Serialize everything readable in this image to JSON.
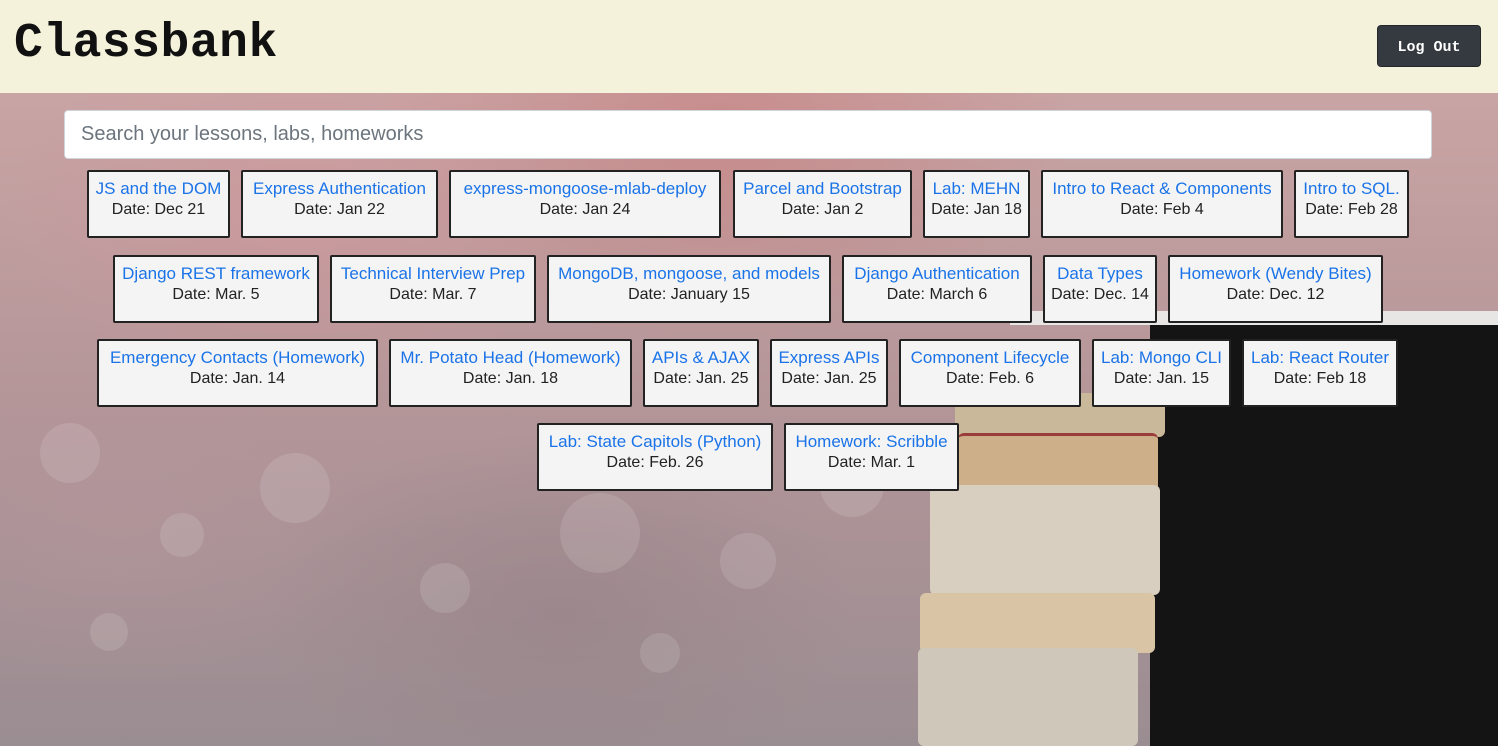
{
  "header": {
    "brand": "Classbank",
    "logout_label": "Log Out",
    "background": "#f5f2dc"
  },
  "search": {
    "placeholder": "Search your lessons, labs, homeworks",
    "value": ""
  },
  "colors": {
    "link": "#1a73e8",
    "button": "#343a40",
    "card_bg": "#f4f4f4"
  },
  "lessons": [
    {
      "title": "JS and the DOM",
      "date": "Date: Dec 21"
    },
    {
      "title": "Express Authentication",
      "date": "Date: Jan 22"
    },
    {
      "title": "express-mongoose-mlab-deploy",
      "date": "Date: Jan 24"
    },
    {
      "title": "Parcel and Bootstrap",
      "date": "Date: Jan 2"
    },
    {
      "title": "Lab: MEHN",
      "date": "Date: Jan 18"
    },
    {
      "title": "Intro to React & Components",
      "date": "Date: Feb 4"
    },
    {
      "title": "Intro to SQL.",
      "date": "Date: Feb 28"
    },
    {
      "title": "Django REST framework",
      "date": "Date: Mar. 5"
    },
    {
      "title": "Technical Interview Prep",
      "date": "Date: Mar. 7"
    },
    {
      "title": "MongoDB, mongoose, and models",
      "date": "Date: January 15"
    },
    {
      "title": "Django Authentication",
      "date": "Date: March 6"
    },
    {
      "title": "Data Types",
      "date": "Date: Dec. 14"
    },
    {
      "title": "Homework (Wendy Bites)",
      "date": "Date: Dec. 12"
    },
    {
      "title": "Emergency Contacts (Homework)",
      "date": "Date: Jan. 14"
    },
    {
      "title": "Mr. Potato Head (Homework)",
      "date": "Date: Jan. 18"
    },
    {
      "title": "APIs & AJAX",
      "date": "Date: Jan. 25"
    },
    {
      "title": "Express APIs",
      "date": "Date: Jan. 25"
    },
    {
      "title": "Component Lifecycle",
      "date": "Date: Feb. 6"
    },
    {
      "title": "Lab: Mongo CLI",
      "date": "Date: Jan. 15"
    },
    {
      "title": "Lab: React Router",
      "date": "Date: Feb 18"
    },
    {
      "title": "Lab: State Capitols (Python)",
      "date": "Date: Feb. 26"
    },
    {
      "title": "Homework: Scribble",
      "date": "Date: Mar. 1"
    }
  ]
}
